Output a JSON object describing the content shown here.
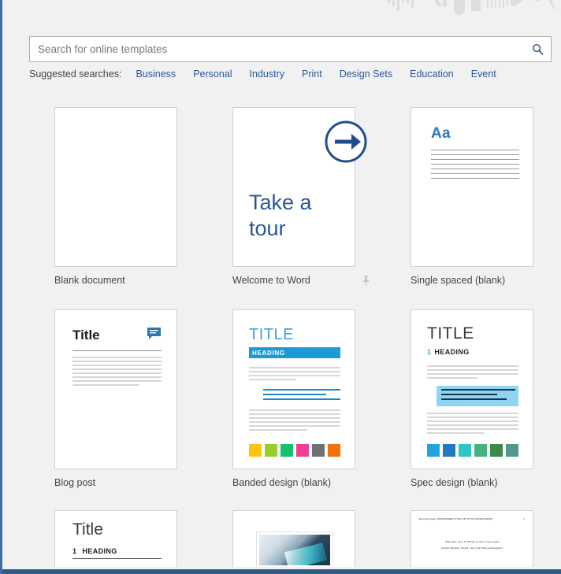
{
  "window": {
    "accent_color": "#2b579a",
    "background": "#f1f1f1"
  },
  "search": {
    "placeholder": "Search for online templates",
    "value": "",
    "icon": "search-icon"
  },
  "suggested": {
    "label": "Suggested searches:",
    "items": [
      {
        "label": "Business"
      },
      {
        "label": "Personal"
      },
      {
        "label": "Industry"
      },
      {
        "label": "Print"
      },
      {
        "label": "Design Sets"
      },
      {
        "label": "Education"
      },
      {
        "label": "Event"
      }
    ]
  },
  "templates": [
    {
      "caption": "Blank document",
      "pinned": false
    },
    {
      "caption": "Welcome to Word",
      "pinned": true,
      "tour_text_line1": "Take a",
      "tour_text_line2": "tour",
      "arrow_icon": "arrow-right-circle-icon",
      "pin_icon": "pin-icon"
    },
    {
      "caption": "Single spaced (blank)",
      "sample_text": "Aa",
      "accent": "#2b76bb"
    },
    {
      "caption": "Blog post",
      "sample_text": "Title",
      "comment_icon": "comment-icon",
      "accent": "#2b76bb"
    },
    {
      "caption": "Banded design (blank)",
      "title_text": "TITLE",
      "heading_text": "HEADING",
      "accent": "#1c9ad6",
      "swatches": [
        "#ffc40d",
        "#9bcb2d",
        "#14c36e",
        "#ef3e96",
        "#6e7277",
        "#f3700b"
      ]
    },
    {
      "caption": "Spec design (blank)",
      "title_text": "TITLE",
      "heading_number": "1",
      "heading_text": "HEADING",
      "accent": "#2bb0d6",
      "swatches": [
        "#22a5de",
        "#2378bf",
        "#2ec6c4",
        "#44b37f",
        "#3b8a4a",
        "#52978e"
      ]
    }
  ],
  "templates_row3": [
    {
      "title_text": "Title",
      "heading_number": "1",
      "heading_text": "HEADING"
    },
    {
      "photo": "landscape-photo"
    },
    {
      "header_left": "Running head: [SHORTENED TITLE UP TO 50 CHARACTERS]",
      "header_right": "1",
      "center_line1": "[Title Here, up to 12 Words, on One to Two Lines]",
      "center_line2": "[Author Name(s), First M. Last, Omit Titles and Degrees]"
    }
  ]
}
